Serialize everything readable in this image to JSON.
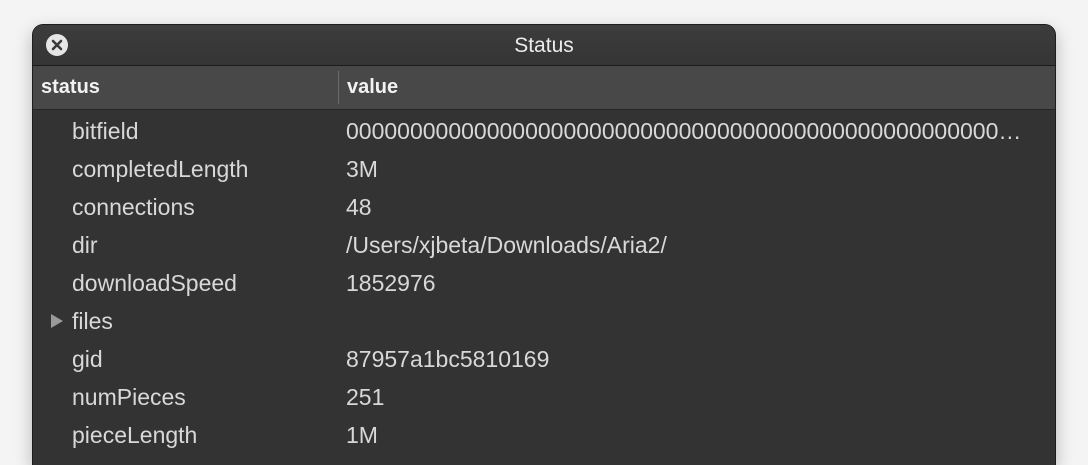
{
  "window": {
    "title": "Status"
  },
  "table": {
    "columns": [
      "status",
      "value"
    ],
    "rows": [
      {
        "key": "bitfield",
        "value": "000000000000000000000000000000000000000000000000000000000000000000",
        "expandable": false
      },
      {
        "key": "completedLength",
        "value": "3M",
        "expandable": false
      },
      {
        "key": "connections",
        "value": "48",
        "expandable": false
      },
      {
        "key": "dir",
        "value": "/Users/xjbeta/Downloads/Aria2/",
        "expandable": false
      },
      {
        "key": "downloadSpeed",
        "value": "1852976",
        "expandable": false
      },
      {
        "key": "files",
        "value": "",
        "expandable": true
      },
      {
        "key": "gid",
        "value": "87957a1bc5810169",
        "expandable": false
      },
      {
        "key": "numPieces",
        "value": "251",
        "expandable": false
      },
      {
        "key": "pieceLength",
        "value": "1M",
        "expandable": false
      }
    ]
  },
  "icons": {
    "close": "close-icon",
    "disclosure": "disclosure-triangle-icon"
  },
  "colors": {
    "window_bg": "#333333",
    "header_bg": "#484848",
    "text": "#d8d8d8"
  }
}
